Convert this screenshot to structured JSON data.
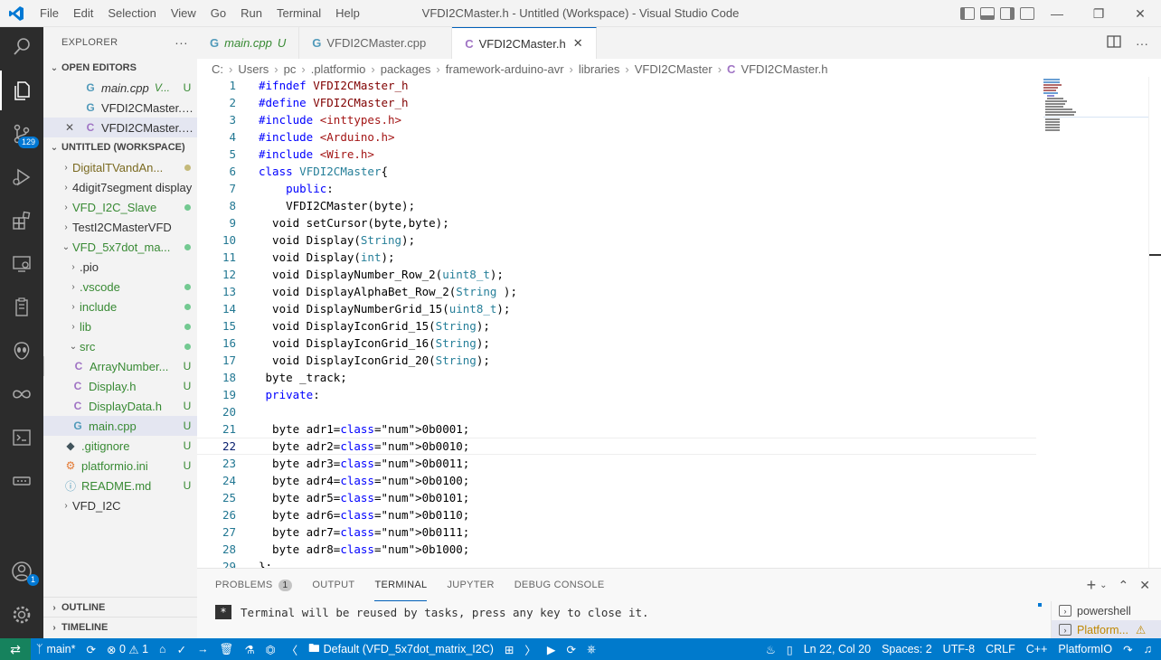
{
  "window": {
    "title": "VFDI2CMaster.h - Untitled (Workspace) - Visual Studio Code",
    "menu": [
      "File",
      "Edit",
      "Selection",
      "View",
      "Go",
      "Run",
      "Terminal",
      "Help"
    ]
  },
  "activity_bar": {
    "scm_badge": "129",
    "accounts_badge": "1"
  },
  "sidebar": {
    "title": "EXPLORER",
    "more": "···",
    "open_editors_label": "OPEN EDITORS",
    "open_editors": [
      {
        "name": "main.cpp",
        "desc": "V...",
        "status": "U",
        "icon": "cpp",
        "close": ""
      },
      {
        "name": "VFDI2CMaster.c...",
        "desc": "",
        "status": "",
        "icon": "cpp",
        "close": ""
      },
      {
        "name": "VFDI2CMaster.h...",
        "desc": "",
        "status": "",
        "icon": "c",
        "close": "✕"
      }
    ],
    "workspace_label": "UNTITLED (WORKSPACE)",
    "tree": [
      {
        "name": "DigitalTVandAn...",
        "arrow": "›",
        "status": "dot-olive"
      },
      {
        "name": "4digit7segment display",
        "arrow": "›",
        "status": ""
      },
      {
        "name": "VFD_I2C_Slave",
        "arrow": "›",
        "status": "dot-green"
      },
      {
        "name": "TestI2CMasterVFD",
        "arrow": "›",
        "status": ""
      },
      {
        "name": "VFD_5x7dot_ma...",
        "arrow": "⌄",
        "status": "dot-green"
      },
      {
        "name": ".pio",
        "arrow": "›",
        "status": ""
      },
      {
        "name": ".vscode",
        "arrow": "›",
        "status": "dot-green"
      },
      {
        "name": "include",
        "arrow": "›",
        "status": "dot-green"
      },
      {
        "name": "lib",
        "arrow": "›",
        "status": "dot-green"
      },
      {
        "name": "src",
        "arrow": "⌄",
        "status": "dot-green"
      },
      {
        "name": "ArrayNumber...",
        "icon": "C",
        "status": "U"
      },
      {
        "name": "Display.h",
        "icon": "C",
        "status": "U"
      },
      {
        "name": "DisplayData.h",
        "icon": "C",
        "status": "U"
      },
      {
        "name": "main.cpp",
        "icon": "G",
        "status": "U"
      },
      {
        "name": ".gitignore",
        "icon": "◆",
        "status": "U"
      },
      {
        "name": "platformio.ini",
        "icon": "⚙",
        "status": "U"
      },
      {
        "name": "README.md",
        "icon": "ⓘ",
        "status": "U"
      },
      {
        "name": "VFD_I2C",
        "arrow": "›",
        "status": ""
      }
    ],
    "outline_label": "OUTLINE",
    "timeline_label": "TIMELINE"
  },
  "tabs": [
    {
      "label": "main.cpp",
      "suffix": "U",
      "icon": "G"
    },
    {
      "label": "VFDI2CMaster.cpp",
      "suffix": "",
      "icon": "G"
    },
    {
      "label": "VFDI2CMaster.h",
      "suffix": "",
      "icon": "C"
    }
  ],
  "breadcrumb": [
    "C:",
    "Users",
    "pc",
    ".platformio",
    "packages",
    "framework-arduino-avr",
    "libraries",
    "VFDI2CMaster",
    "VFDI2CMaster.h"
  ],
  "code_lines": [
    {
      "n": "1",
      "t": "#ifndef VFDI2CMaster_h"
    },
    {
      "n": "2",
      "t": "#define VFDI2CMaster_h"
    },
    {
      "n": "3",
      "t": "#include <inttypes.h>"
    },
    {
      "n": "4",
      "t": "#include <Arduino.h>"
    },
    {
      "n": "5",
      "t": "#include <Wire.h>"
    },
    {
      "n": "6",
      "t": "class VFDI2CMaster{"
    },
    {
      "n": "7",
      "t": "    public:"
    },
    {
      "n": "8",
      "t": "    VFDI2CMaster(byte);"
    },
    {
      "n": "9",
      "t": "  void setCursor(byte,byte);"
    },
    {
      "n": "10",
      "t": "  void Display(String);"
    },
    {
      "n": "11",
      "t": "  void Display(int);"
    },
    {
      "n": "12",
      "t": "  void DisplayNumber_Row_2(uint8_t);"
    },
    {
      "n": "13",
      "t": "  void DisplayAlphaBet_Row_2(String );"
    },
    {
      "n": "14",
      "t": "  void DisplayNumberGrid_15(uint8_t);"
    },
    {
      "n": "15",
      "t": "  void DisplayIconGrid_15(String);"
    },
    {
      "n": "16",
      "t": "  void DisplayIconGrid_16(String);"
    },
    {
      "n": "17",
      "t": "  void DisplayIconGrid_20(String);"
    },
    {
      "n": "18",
      "t": " byte _track;"
    },
    {
      "n": "19",
      "t": " private:"
    },
    {
      "n": "20",
      "t": ""
    },
    {
      "n": "21",
      "t": "  byte adr1=0b0001;"
    },
    {
      "n": "22",
      "t": "  byte adr2=0b0010;"
    },
    {
      "n": "23",
      "t": "  byte adr3=0b0011;"
    },
    {
      "n": "24",
      "t": "  byte adr4=0b0100;"
    },
    {
      "n": "25",
      "t": "  byte adr5=0b0101;"
    },
    {
      "n": "26",
      "t": "  byte adr6=0b0110;"
    },
    {
      "n": "27",
      "t": "  byte adr7=0b0111;"
    },
    {
      "n": "28",
      "t": "  byte adr8=0b1000;"
    },
    {
      "n": "29",
      "t": "};"
    }
  ],
  "current_line": "22",
  "panel": {
    "tabs": [
      {
        "label": "PROBLEMS",
        "badge": "1"
      },
      {
        "label": "OUTPUT"
      },
      {
        "label": "TERMINAL"
      },
      {
        "label": "JUPYTER"
      },
      {
        "label": "DEBUG CONSOLE"
      }
    ],
    "active_tab": "TERMINAL",
    "terminal_text": "Terminal will be reused by tasks, press any key to close it.",
    "terminals": [
      "powershell",
      "Platform..."
    ]
  },
  "statusbar": {
    "branch": "main*",
    "errors": "0",
    "warnings": "1",
    "env": "Default (VFD_5x7dot_matrix_I2C)",
    "position": "Ln 22, Col 20",
    "spaces": "Spaces: 2",
    "encoding": "UTF-8",
    "eol": "CRLF",
    "language": "C++",
    "platform": "PlatformIO"
  },
  "colors": {
    "accent": "#007acc",
    "activity_bg": "#2c2c2c",
    "sidebar_bg": "#f3f3f3",
    "remote_bg": "#16825d"
  }
}
